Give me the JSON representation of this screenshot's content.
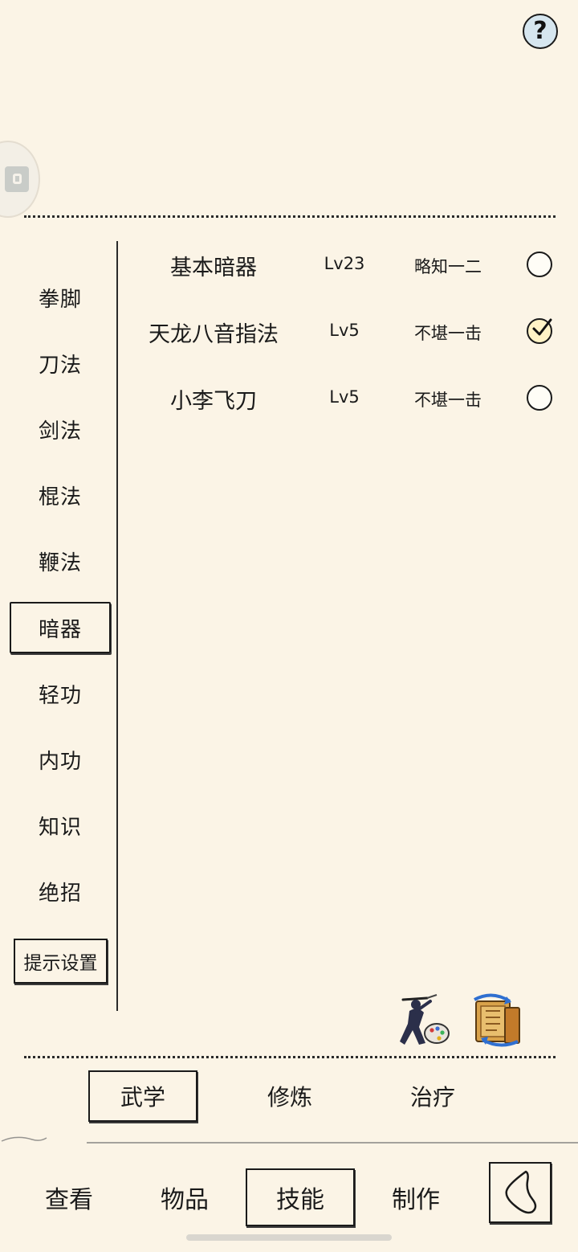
{
  "help": {
    "icon": "question-icon",
    "label": "?"
  },
  "categories": [
    {
      "label": "拳脚",
      "active": false
    },
    {
      "label": "刀法",
      "active": false
    },
    {
      "label": "剑法",
      "active": false
    },
    {
      "label": "棍法",
      "active": false
    },
    {
      "label": "鞭法",
      "active": false
    },
    {
      "label": "暗器",
      "active": true
    },
    {
      "label": "轻功",
      "active": false
    },
    {
      "label": "内功",
      "active": false
    },
    {
      "label": "知识",
      "active": false
    },
    {
      "label": "绝招",
      "active": false
    }
  ],
  "hint_settings_label": "提示设置",
  "skills": [
    {
      "name": "基本暗器",
      "level": "Lv23",
      "rank": "略知一二",
      "selected": false
    },
    {
      "name": "天龙八音指法",
      "level": "Lv5",
      "rank": "不堪一击",
      "selected": true
    },
    {
      "name": "小李飞刀",
      "level": "Lv5",
      "rank": "不堪一击",
      "selected": false
    }
  ],
  "tools": [
    {
      "icon": "martial-artist-palette-icon"
    },
    {
      "icon": "scroll-swap-icon"
    }
  ],
  "subtabs": [
    {
      "label": "武学",
      "active": true
    },
    {
      "label": "修炼",
      "active": false
    },
    {
      "label": "治疗",
      "active": false
    }
  ],
  "nav": [
    {
      "label": "查看",
      "active": false
    },
    {
      "label": "物品",
      "active": false
    },
    {
      "label": "技能",
      "active": true
    },
    {
      "label": "制作",
      "active": false
    }
  ],
  "colors": {
    "background": "#fbf4e6",
    "ink": "#1a1a1a",
    "help_button": "#d6e6ef",
    "selected_radio": "#fff3c6"
  }
}
